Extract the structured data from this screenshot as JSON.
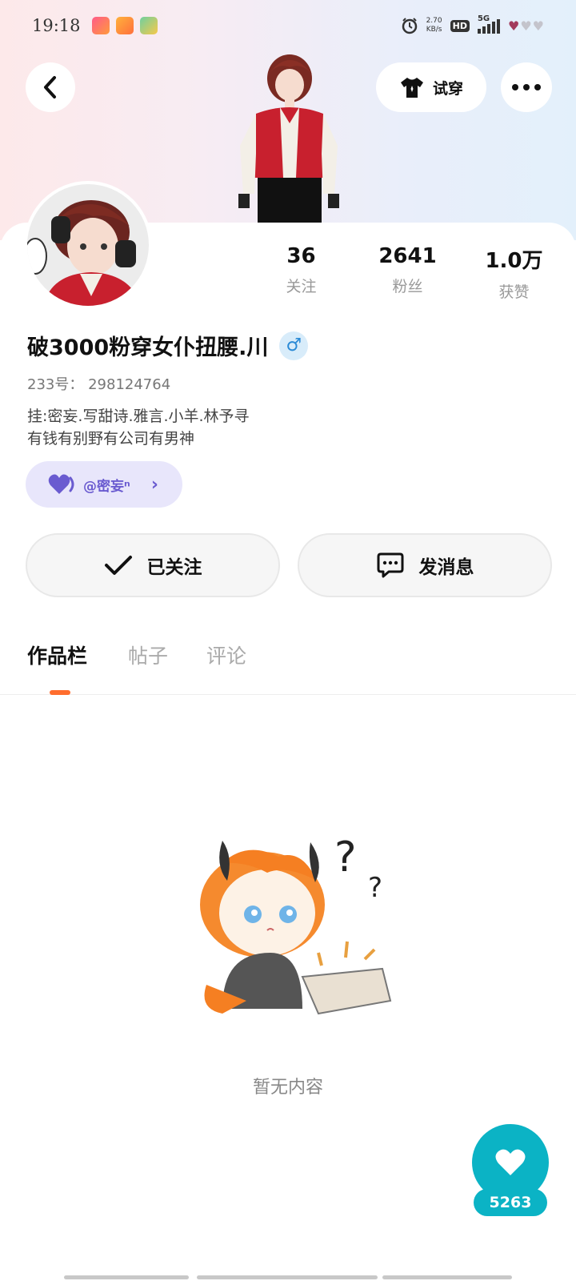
{
  "status_bar": {
    "time": "19:18",
    "net_speed_value": "2.70",
    "net_speed_unit": "KB/s",
    "hd": "HD",
    "network": "5G",
    "icons": [
      "app-notification-icon",
      "app-notification-icon",
      "app-notification-icon",
      "alarm-icon",
      "signal-icon",
      "battery-icon"
    ]
  },
  "header": {
    "tryon_label": "试穿"
  },
  "profile": {
    "username": "破3000粉穿女仆扭腰.川",
    "gender_symbol": "♂",
    "uid_label": "233号：",
    "uid": "298124764",
    "bio_line1": "挂:密妄.写甜诗.雅言.小羊.林予寻",
    "bio_line2": "有钱有别野有公司有男神",
    "cp_tag": "@密妄ⁿ"
  },
  "stats": [
    {
      "value": "36",
      "label": "关注"
    },
    {
      "value": "2641",
      "label": "粉丝"
    },
    {
      "value": "1.0万",
      "label": "获赞"
    }
  ],
  "actions": {
    "follow_label": "已关注",
    "message_label": "发消息"
  },
  "tabs": [
    {
      "label": "作品栏",
      "active": true
    },
    {
      "label": "帖子",
      "active": false
    },
    {
      "label": "评论",
      "active": false
    }
  ],
  "empty": {
    "text": "暂无内容"
  },
  "like_fab": {
    "count": "5263"
  },
  "colors": {
    "accent_orange": "#ff6d2e",
    "fab_teal": "#0bb3c5",
    "cp_purple": "#6a5bd0"
  }
}
